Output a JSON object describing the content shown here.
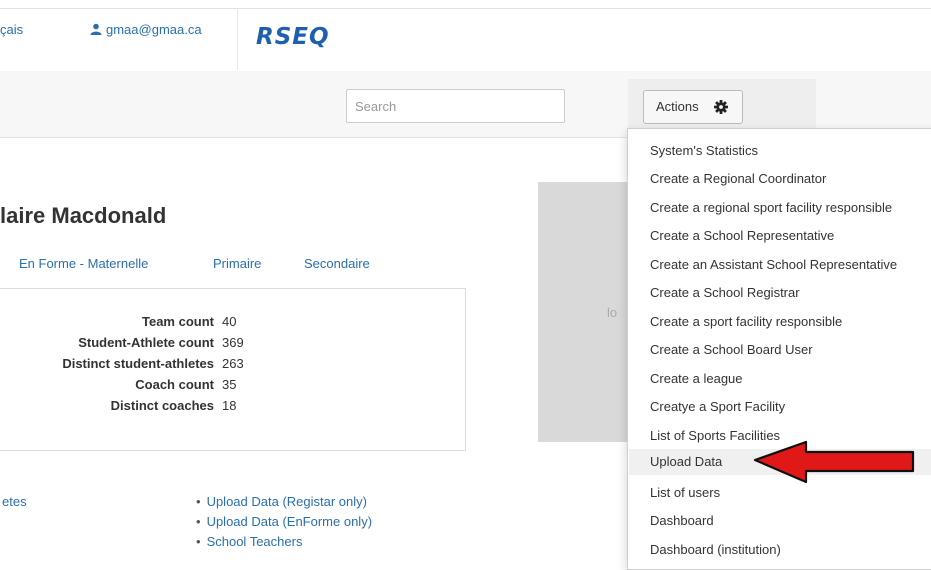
{
  "header": {
    "language_link": "çais",
    "user_email": "gmaa@gmaa.ca",
    "logo_text": "RSEQ",
    "user_icon": "user-icon"
  },
  "toolbar": {
    "search_placeholder": "Search",
    "actions_label": "Actions",
    "actions_icon": "gear-icon"
  },
  "actions_menu": {
    "items": [
      "System's Statistics",
      "Create a Regional Coordinator",
      "Create a regional sport facility responsible",
      "Create a School Representative",
      "Create an Assistant School Representative",
      "Create a School Registrar",
      "Create a sport facility responsible",
      "Create a School Board User",
      "Create a league",
      "Creatye a Sport Facility",
      "List of Sports Facilities",
      "Upload Data",
      "List of users",
      "Dashboard",
      "Dashboard (institution)"
    ],
    "highlighted": "Upload Data"
  },
  "profile": {
    "name": "laire Macdonald",
    "tabs": [
      "En Forme - Maternelle",
      "Primaire",
      "Secondaire"
    ]
  },
  "stats": {
    "rows": [
      {
        "label": "Team count",
        "value": "40"
      },
      {
        "label": "Student-Athlete count",
        "value": "369"
      },
      {
        "label": "Distinct student-athletes",
        "value": "263"
      },
      {
        "label": "Coach count",
        "value": "35"
      },
      {
        "label": "Distinct coaches",
        "value": "18"
      }
    ]
  },
  "side_panel": {
    "partial_text": "lo"
  },
  "links": {
    "left_partial": "etes",
    "list": [
      "Upload Data (Registar only)",
      "Upload Data (EnForme only)",
      "School Teachers"
    ]
  },
  "annotation": {
    "arrow_color": "#e01818"
  }
}
